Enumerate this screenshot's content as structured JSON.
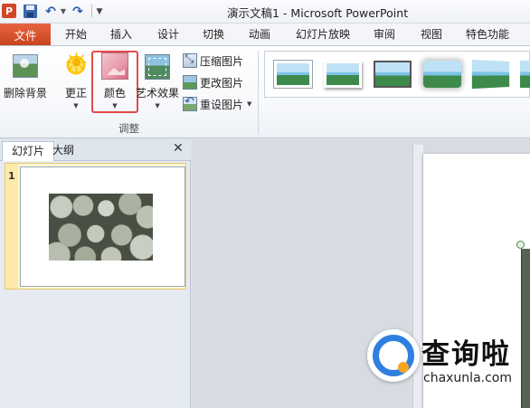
{
  "window": {
    "title": "演示文稿1 - Microsoft PowerPoint",
    "app_logo": "P"
  },
  "quick_access": {
    "items": [
      "save-icon",
      "undo-icon",
      "redo-icon",
      "customize-icon"
    ]
  },
  "tabs": {
    "file": "文件",
    "items": [
      "开始",
      "插入",
      "设计",
      "切换",
      "动画",
      "幻灯片放映",
      "审阅",
      "视图",
      "特色功能"
    ]
  },
  "ribbon": {
    "remove_background": "删除背景",
    "corrections": "更正",
    "color": "颜色",
    "artistic_effects": "艺术效果",
    "compress_pictures": "压缩图片",
    "change_picture": "更改图片",
    "reset_picture": "重设图片",
    "group_label": "调整"
  },
  "slides_pane": {
    "tab_slides": "幻灯片",
    "tab_outline": "大纲",
    "close": "✕",
    "slide_number": "1"
  },
  "watermark": {
    "text": "查询啦",
    "url": "chaxunla.com"
  }
}
